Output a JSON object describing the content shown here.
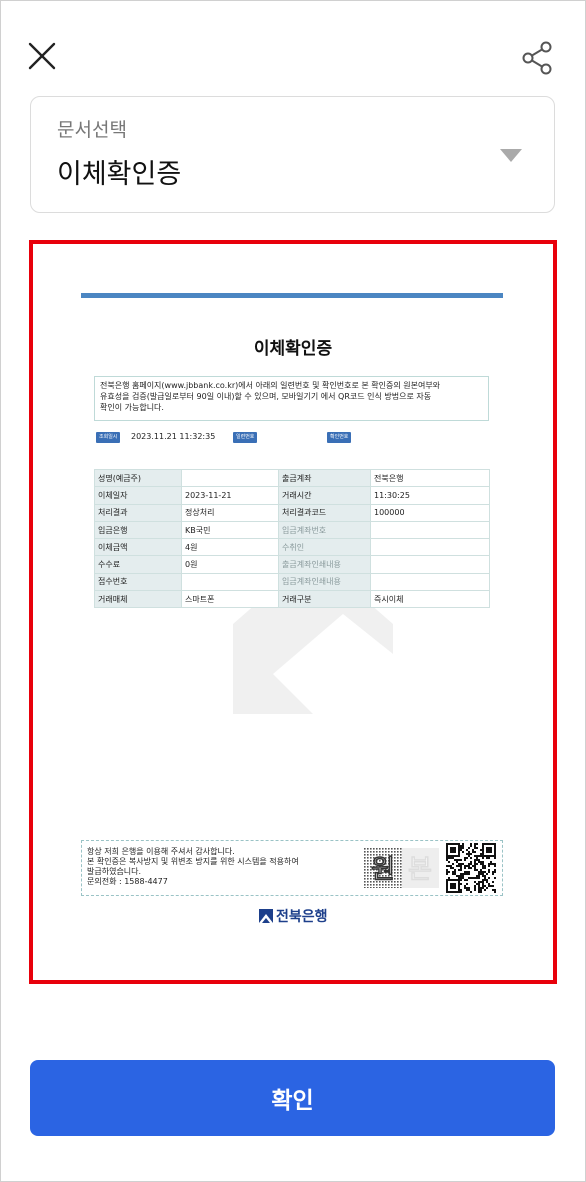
{
  "header": {
    "close_icon": "close-icon",
    "share_icon": "share-icon"
  },
  "document_select": {
    "label": "문서선택",
    "value": "이체확인증",
    "caret_icon": "caret-down-icon"
  },
  "document": {
    "title": "이체확인증",
    "notice_lines": [
      "전북은행 홈페이지(www.jbbank.co.kr)에서 아래의 일련번호 및 확인번호로 본 확인증의 원본여부와",
      "유효성을 검증(발급일로부터 90일 이내)할 수 있으며, 모바일기기 에서 QR코드 인식 방법으로 자동",
      "확인이 가능합니다."
    ],
    "meta": {
      "inquiry_tag": "조회일시",
      "inquiry_datetime": "2023.11.21 11:32:35",
      "serial_tag": "일련번호",
      "confirm_tag": "확인번호"
    },
    "rows": [
      {
        "l1": "성명(예금주)",
        "v1": "",
        "l2": "출금계좌",
        "v2": "전북은행"
      },
      {
        "l1": "이체일자",
        "v1": "2023-11-21",
        "l2": "거래시간",
        "v2": "11:30:25"
      },
      {
        "l1": "처리결과",
        "v1": "정상처리",
        "l2": "처리결과코드",
        "v2": "100000"
      },
      {
        "l1": "입금은행",
        "v1": "KB국민",
        "l2": "입금계좌번호",
        "v2": ""
      },
      {
        "l1": "이체금액",
        "v1": "4원",
        "l2": "수취인",
        "v2": ""
      },
      {
        "l1": "수수료",
        "v1": "0원",
        "l2": "출금계좌인쇄내용",
        "v2": ""
      },
      {
        "l1": "접수번호",
        "v1": "",
        "l2": "입금계좌인쇄내용",
        "v2": ""
      },
      {
        "l1": "거래매체",
        "v1": "스마트폰",
        "l2": "거래구분",
        "v2": "즉시이체"
      }
    ],
    "footer_lines": [
      "항상 저희 은행을 이용해 주셔서 감사합니다.",
      "본 확인증은 복사방지 및 위변조 방지를 위한 시스템을 적용하여",
      "발급하였습니다.",
      "문의전화 : 1588-4477"
    ],
    "seal_text": "원본",
    "bank_name": "전북은행"
  },
  "confirm_button": {
    "label": "확인"
  },
  "colors": {
    "accent": "#2b64e3",
    "frame_border": "#e8000b",
    "doc_bar": "#4b86c2",
    "bank_brand": "#1d3f8b"
  }
}
